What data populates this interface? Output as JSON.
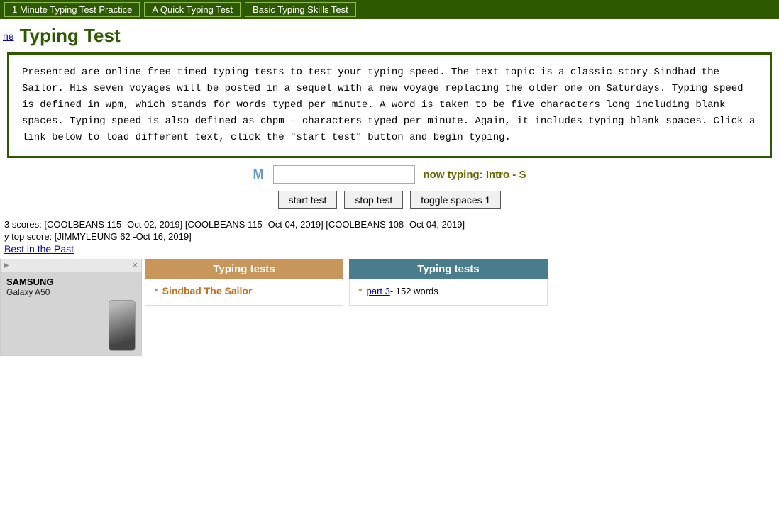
{
  "topNav": {
    "links": [
      {
        "label": "1 Minute Typing Test Practice",
        "id": "nav-1min"
      },
      {
        "label": "A Quick Typing Test",
        "id": "nav-quick"
      },
      {
        "label": "Basic Typing Skills Test",
        "id": "nav-basic"
      }
    ]
  },
  "header": {
    "homeLabel": "ne",
    "title": "Typing Test"
  },
  "description": {
    "text": "Presented are online free timed typing tests to test your typing speed. The text topic is a classic story Sindbad the Sailor. His seven voyages will be posted in a sequel with a new voyage replacing the older one on Saturdays. Typing speed is defined in wpm, which stands for words typed per minute. A word is taken to be five characters long including blank spaces. Typing speed is also defined as chpm - characters typed per minute. Again, it includes typing blank spaces. Click a link below to load different text, click the \"start test\" button and begin typing."
  },
  "typingArea": {
    "letter": "M",
    "inputPlaceholder": "",
    "nowTypingLabel": "now typing: Intro - S"
  },
  "buttons": {
    "startTest": "start test",
    "stopTest": "stop test",
    "toggleSpaces": "toggle spaces 1"
  },
  "scores": {
    "topScoresLine": "3 scores: [COOLBEANS 115 -Oct 02, 2019] [COOLBEANS 115 -Oct 04, 2019] [COOLBEANS 108 -Oct 04, 2019]",
    "topScoreLabel": "y top score: [JIMMYLEUNG 62 -Oct 16, 2019]",
    "bestLinkLabel": "Best in the Past"
  },
  "ad": {
    "adLabel": "▶",
    "closeLabel": "✕",
    "brand": "SAMSUNG",
    "model": "Galaxy A50"
  },
  "typingTestsPanelLeft": {
    "header": "Typing tests",
    "items": [
      {
        "text": "Sindbad The Sailor",
        "isLink": true,
        "linkColor": "tan"
      }
    ]
  },
  "typingTestsPanelRight": {
    "header": "Typing tests",
    "items": [
      {
        "linkText": "part 3",
        "rest": " - 152 words",
        "isLink": true
      }
    ]
  }
}
